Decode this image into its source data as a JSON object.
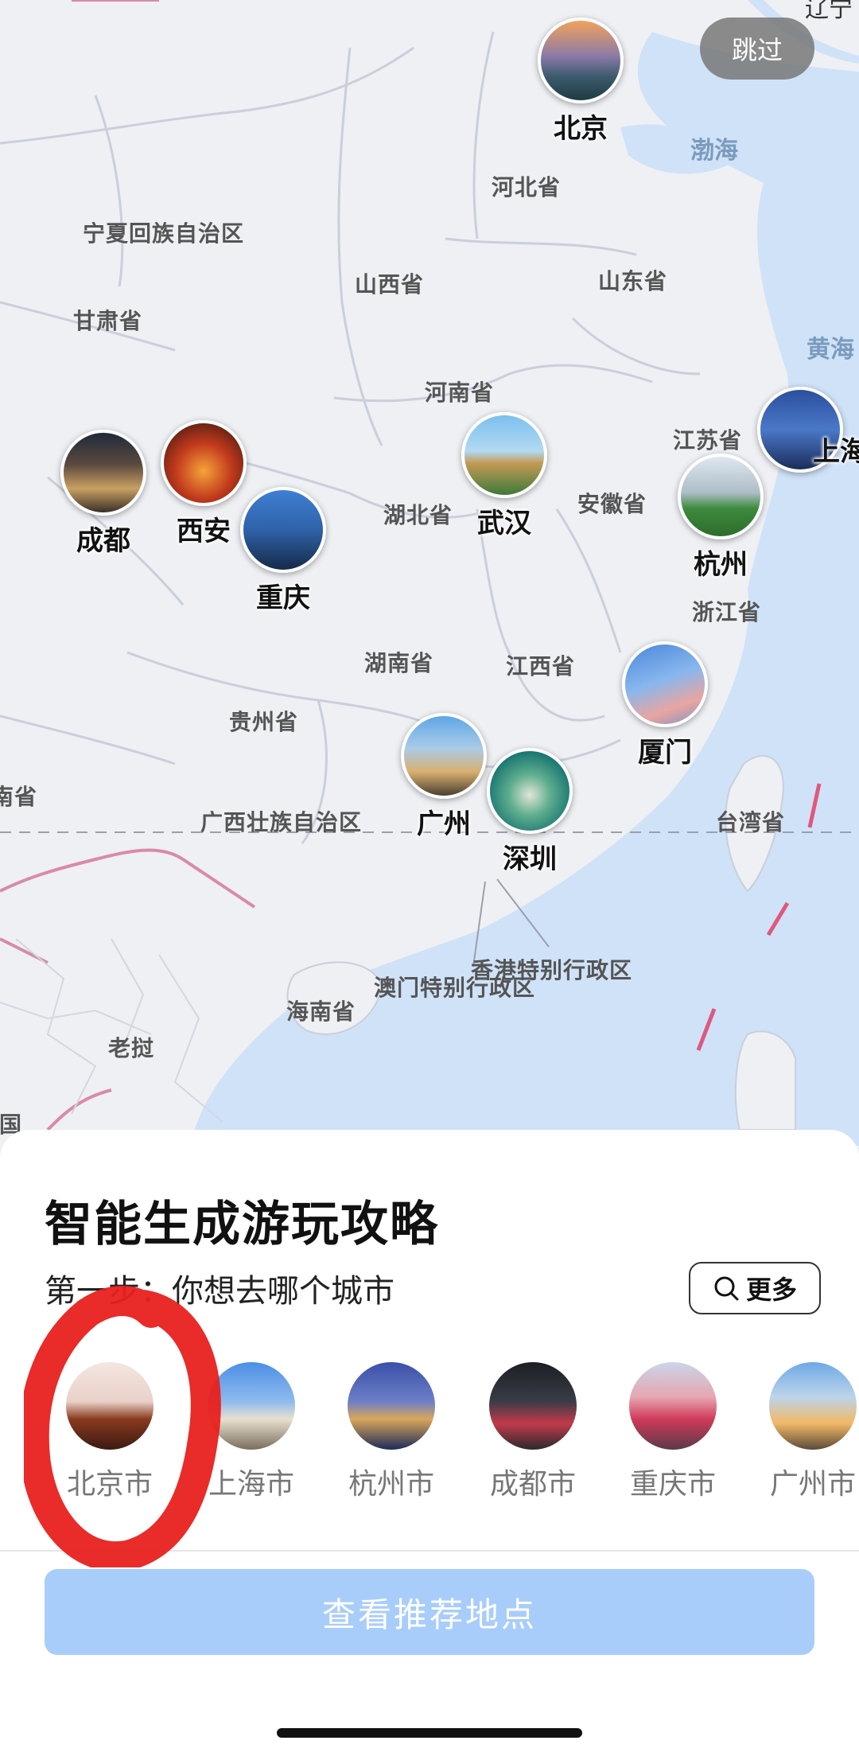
{
  "map": {
    "top_right_partial": "辽宁",
    "skip_label": "跳过",
    "seas": [
      {
        "name": "渤海"
      },
      {
        "name": "黄海"
      }
    ],
    "provinces": [
      "宁夏回族自治区",
      "甘肃省",
      "山西省",
      "河北省",
      "山东省",
      "河南省",
      "江苏省",
      "安徽省",
      "湖北省",
      "浙江省",
      "湖南省",
      "江西省",
      "贵州省",
      "广西壮族自治区",
      "台湾省",
      "云南省",
      "香港特别行政区",
      "澳门特别行政区",
      "海南省",
      "老挝",
      "泰国"
    ],
    "cities": [
      "北京",
      "成都",
      "西安",
      "重庆",
      "武汉",
      "上海",
      "杭州",
      "厦门",
      "广州",
      "深圳"
    ]
  },
  "sheet": {
    "title": "智能生成游玩攻略",
    "step": "第一步：你想去哪个城市",
    "more_label": "更多",
    "city_options": [
      "北京市",
      "上海市",
      "杭州市",
      "成都市",
      "重庆市",
      "广州市"
    ],
    "cta_label": "查看推荐地点"
  },
  "colors": {
    "land": "#eef0f4",
    "sea": "#cfe2f8",
    "border": "#c9cfdb",
    "national_border": "#d98aa8",
    "cta": "#a9cdfa",
    "marker": "#e8201e"
  }
}
